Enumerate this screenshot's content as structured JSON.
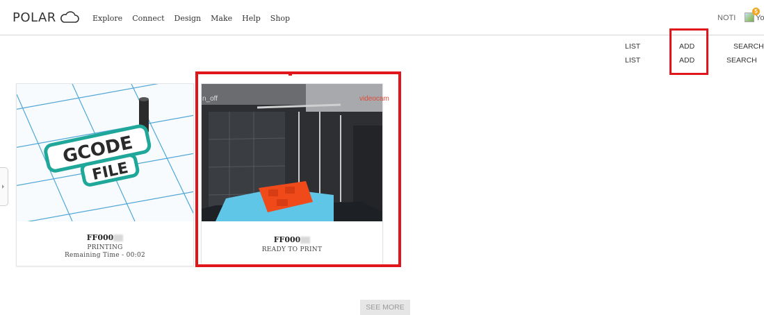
{
  "header": {
    "logo_text": "POLAR",
    "nav": [
      "Explore",
      "Connect",
      "Design",
      "Make",
      "Help",
      "Shop"
    ],
    "notifications_label": "NOTI",
    "notification_count": "5",
    "avatar_alt": "Yo"
  },
  "actions": {
    "row1": {
      "list": "LIST",
      "add": "ADD",
      "search": "SEARCH"
    },
    "row2": {
      "list": "LIST",
      "add": "ADD",
      "search": "SEARCH"
    }
  },
  "printers": [
    {
      "name": "FF000",
      "status": "PRINTING",
      "remaining": "Remaining Time - 00:02",
      "image_icon": "gcode-file-thumbnail",
      "image_text": [
        "GCODE",
        "FILE"
      ]
    },
    {
      "name": "FF000",
      "status": "READY TO PRINT",
      "image_icon": "printer-camera-view",
      "camera_off_label": "n_off",
      "camera_label": "videocam"
    }
  ],
  "see_more": "SEE MORE",
  "colors": {
    "highlight": "#e0161b",
    "card_border": "#e3e3e3",
    "gcode_teal": "#1fa79a",
    "print_orange": "#f04a1a",
    "bed_blue": "#5fc6e8"
  }
}
